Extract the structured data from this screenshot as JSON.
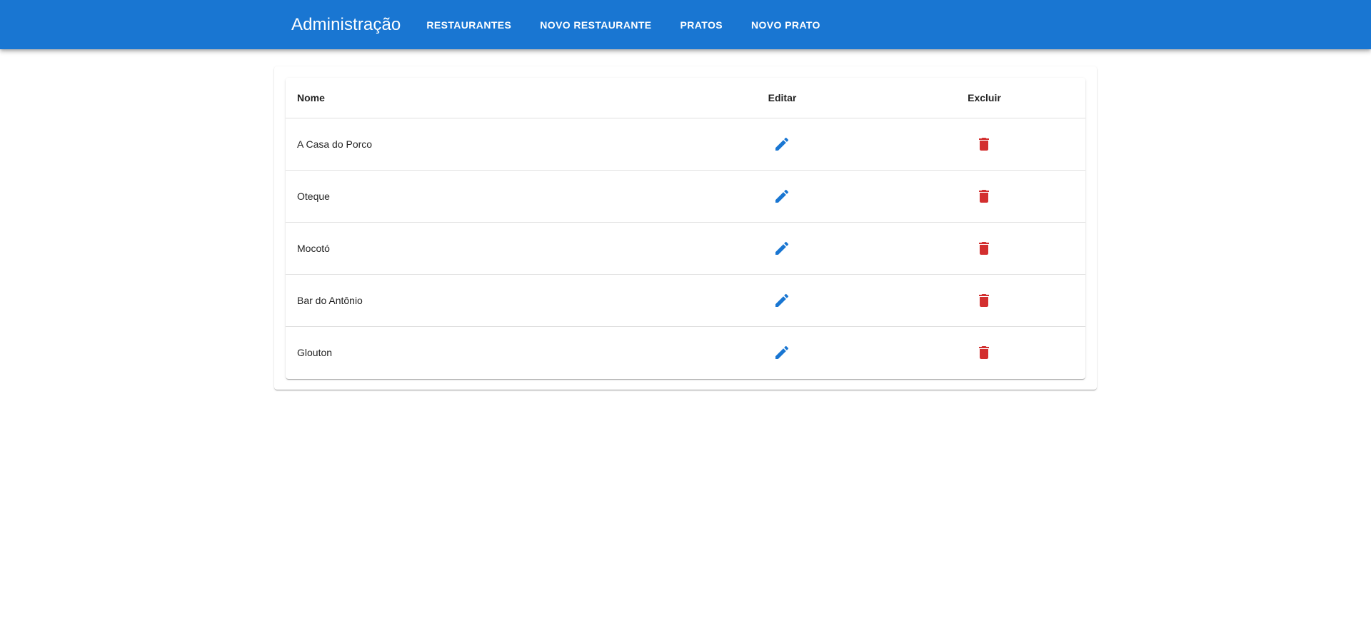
{
  "appbar": {
    "title": "Administração",
    "nav": [
      {
        "label": "RESTAURANTES"
      },
      {
        "label": "NOVO RESTAURANTE"
      },
      {
        "label": "PRATOS"
      },
      {
        "label": "NOVO PRATO"
      }
    ],
    "color": "#1976d2"
  },
  "table": {
    "headers": {
      "name": "Nome",
      "edit": "Editar",
      "delete": "Excluir"
    },
    "rows": [
      {
        "name": "A Casa do Porco",
        "edit_icon": "pencil-icon",
        "delete_icon": "trash-icon"
      },
      {
        "name": "Oteque",
        "edit_icon": "pencil-icon",
        "delete_icon": "trash-icon"
      },
      {
        "name": "Mocotó",
        "edit_icon": "pencil-icon",
        "delete_icon": "trash-icon"
      },
      {
        "name": "Bar do Antônio",
        "edit_icon": "pencil-icon",
        "delete_icon": "trash-icon"
      },
      {
        "name": "Glouton",
        "edit_icon": "pencil-icon",
        "delete_icon": "trash-icon"
      }
    ],
    "edit_color": "#1976d2",
    "delete_color": "#d32f2f"
  }
}
